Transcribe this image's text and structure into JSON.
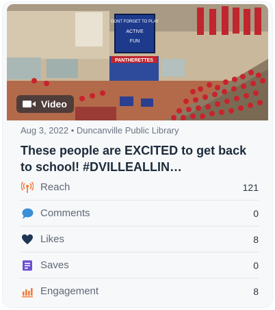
{
  "post": {
    "media_type": "Video",
    "meta": "Aug 3, 2022 • Duncanville Public Library",
    "title": "These people are EXCITED to get back to school! #DVILLEALLIN…",
    "scoreboard_text": [
      "DONT FORGET TO PLAY",
      "ACTIVE",
      "FUN"
    ],
    "banner_text": "PANTHERETTES"
  },
  "stats": [
    {
      "label": "Reach",
      "value": "121",
      "icon": "reach-icon",
      "color": "#f07a3a"
    },
    {
      "label": "Comments",
      "value": "0",
      "icon": "comment-icon",
      "color": "#3a8fd8"
    },
    {
      "label": "Likes",
      "value": "8",
      "icon": "heart-icon",
      "color": "#1f3554"
    },
    {
      "label": "Saves",
      "value": "0",
      "icon": "saves-icon",
      "color": "#6a4fd0"
    },
    {
      "label": "Engagement",
      "value": "8",
      "icon": "engagement-icon",
      "color": "#f07a3a"
    }
  ]
}
